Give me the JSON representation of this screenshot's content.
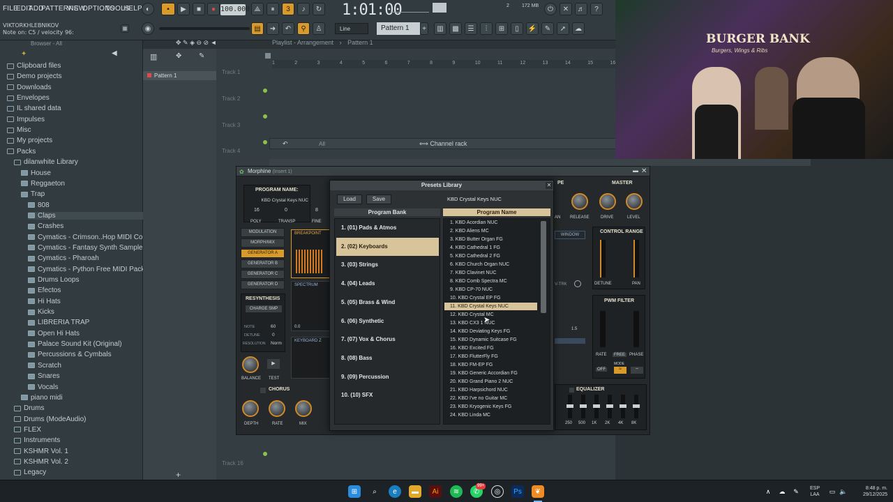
{
  "menu": [
    "FILE",
    "EDIT",
    "ADD",
    "PATTERNS",
    "VIEW",
    "OPTIONS",
    "TOOLS",
    "HELP"
  ],
  "top": {
    "user": "VIKTORKHLEBNIKOV",
    "note_hint": "Note on: C5 / velocity 96:",
    "bpm": "100.000",
    "time": "1:01:00",
    "cpu_num": "2",
    "memory": "172 MB",
    "mode": "Line",
    "pattern_name": "Pattern 1"
  },
  "browser": {
    "title": "Browser - All",
    "items": [
      {
        "label": "Clipboard files",
        "indent": 0
      },
      {
        "label": "Demo projects",
        "indent": 0
      },
      {
        "label": "Downloads",
        "indent": 0
      },
      {
        "label": "Envelopes",
        "indent": 0
      },
      {
        "label": "IL shared data",
        "indent": 0
      },
      {
        "label": "Impulses",
        "indent": 0
      },
      {
        "label": "Misc",
        "indent": 0
      },
      {
        "label": "My projects",
        "indent": 0
      },
      {
        "label": "Packs",
        "indent": 0
      },
      {
        "label": "dilanwhite Library",
        "indent": 1
      },
      {
        "label": "House",
        "indent": 2
      },
      {
        "label": "Reggaeton",
        "indent": 2
      },
      {
        "label": "Trap",
        "indent": 2
      },
      {
        "label": "808",
        "indent": 3
      },
      {
        "label": "Claps",
        "indent": 3
      },
      {
        "label": "Crashes",
        "indent": 3
      },
      {
        "label": "Cymatics - Crimson..Hop MIDI Collection",
        "indent": 3
      },
      {
        "label": "Cymatics - Fantasy Synth Sample Pack",
        "indent": 3
      },
      {
        "label": "Cymatics - Pharoah",
        "indent": 3
      },
      {
        "label": "Cymatics - Python Free MIDI Pack",
        "indent": 3
      },
      {
        "label": "Drums Loops",
        "indent": 3
      },
      {
        "label": "Efectos",
        "indent": 3
      },
      {
        "label": "Hi Hats",
        "indent": 3
      },
      {
        "label": "Kicks",
        "indent": 3
      },
      {
        "label": "LIBRERIA TRAP",
        "indent": 3
      },
      {
        "label": "Open Hi Hats",
        "indent": 3
      },
      {
        "label": "Palace Sound Kit (Original)",
        "indent": 3
      },
      {
        "label": "Percussions & Cymbals",
        "indent": 3
      },
      {
        "label": "Scratch",
        "indent": 3
      },
      {
        "label": "Snares",
        "indent": 3
      },
      {
        "label": "Vocals",
        "indent": 3
      },
      {
        "label": "piano midi",
        "indent": 2
      },
      {
        "label": "Drums",
        "indent": 1
      },
      {
        "label": "Drums (ModeAudio)",
        "indent": 1
      },
      {
        "label": "FLEX",
        "indent": 1
      },
      {
        "label": "Instruments",
        "indent": 1
      },
      {
        "label": "KSHMR Vol. 1",
        "indent": 1
      },
      {
        "label": "KSHMR Vol. 2",
        "indent": 1
      },
      {
        "label": "Legacy",
        "indent": 1
      }
    ]
  },
  "patterns": {
    "item": "Pattern 1"
  },
  "playlist": {
    "title": "Playlist - Arrangement",
    "pattern": "Pattern 1",
    "ruler": [
      "1",
      "2",
      "3",
      "4",
      "5",
      "6",
      "7",
      "8",
      "9",
      "10",
      "11",
      "12",
      "13",
      "14",
      "15",
      "16"
    ],
    "tracks": [
      "Track 1",
      "Track 2",
      "Track 3",
      "Track 4",
      "Track 16"
    ]
  },
  "channel_rack": {
    "filter": "All",
    "title": "Channel rack"
  },
  "morphine": {
    "title": "Morphine",
    "insert": "(Insert 1)",
    "program_name_label": "PROGRAM NAME:",
    "program_name": "KBD Crystal Keys NUC",
    "poly": "16",
    "transp": "0",
    "fine": "8",
    "param_labels": [
      "POLY",
      "TRANSP",
      "FINE"
    ],
    "buttons": [
      "MODULATION",
      "MORPH/MIX",
      "GENERATOR A",
      "GENERATOR B",
      "GENERATOR C",
      "GENERATOR D"
    ],
    "resynthesis": "RESYNTHESIS",
    "charge_smp": "CHARGE SMP",
    "note_label": "NOTE",
    "note_val": "60",
    "detune_label": "DETUNE",
    "detune_val": "0",
    "resolution_label": "RESOLUTION",
    "resolution_val": "Norm",
    "balance": "BALANCE",
    "test": "TEST",
    "chorus": "CHORUS",
    "chorus_knobs": [
      "DEPTH",
      "RATE",
      "MIX"
    ],
    "breakpoint": "BREAKPOINT",
    "spectrum": "SPECTRUM",
    "keyboard": "KEYBOARD Z",
    "master": "MASTER",
    "master_knobs": [
      "RELEASE",
      "DRIVE",
      "LEVEL"
    ],
    "control_range": "CONTROL RANGE",
    "detune": "DETUNE",
    "pan": "PAN",
    "pwm_filter": "PWM FILTER",
    "pwm_labels": [
      "RATE",
      "FREE",
      "PHASE"
    ],
    "mode": "MODE",
    "off": "OFF",
    "equalizer": "EQUALIZER",
    "eq_bands": [
      "250",
      "500",
      "1K",
      "2K",
      "4K",
      "8K"
    ],
    "window": "WINDOW",
    "pe": "PE",
    "an": "AN",
    "vtrk": "V-TRK",
    "ratio": "1.5",
    "scale_val": "0.0"
  },
  "presets": {
    "title": "Presets Library",
    "load": "Load",
    "save": "Save",
    "current": "KBD Crystal Keys NUC",
    "bank_header": "Program Bank",
    "name_header": "Program Name",
    "banks": [
      "1. (01) Pads & Atmos",
      "2. (02) Keyboards",
      "3. (03) Strings",
      "4. (04) Leads",
      "5. (05) Brass & Wind",
      "6. (06) Synthetic",
      "7. (07) Vox & Chorus",
      "8. (08) Bass",
      "9. (09) Percussion",
      "10. (10) SFX"
    ],
    "selected_bank": 1,
    "programs": [
      "1. KBD Acordian NUC",
      "2. KBD Aliens MC",
      "3. KBD Butter Organ FG",
      "4. KBD Cathedral 1 FG",
      "5. KBD Cathedral 2 FG",
      "6. KBD Church Organ NUC",
      "7. KBD Clavinet NUC",
      "8. KBD Comb Spectra MC",
      "9. KBD CP-70 NUC",
      "10. KBD Crystal EP FG",
      "11. KBD Crystal Keys NUC",
      "12. KBD Crystal MC",
      "13. KBD CX3 1 NUC",
      "14. KBD Deviating Keys FG",
      "15. KBD Dynamic Suitcase FG",
      "16. KBD Excited FG",
      "17. KBD FlutterFly FG",
      "18. KBD FM-EP FG",
      "19. KBD Generic Accordian FG",
      "20. KBD Grand Piano 2 NUC",
      "21. KBD Harpsichord NUC",
      "22. KBD I've no Guitar MC",
      "23. KBD Kryogenic Keys FG",
      "24. KBD Linda MC"
    ],
    "selected_program": 10
  },
  "webcam": {
    "sign": "BURGER BANK",
    "sign_sub": "Burgers, Wings & Ribs"
  },
  "taskbar": {
    "lang": "ESP",
    "lang2": "LAA",
    "time": "8:48 p. m.",
    "date": "29/12/2025",
    "badge": "99+"
  },
  "colors": {
    "accent": "#d8c49b",
    "orange": "#d89a2b",
    "bg": "#2b3336"
  }
}
